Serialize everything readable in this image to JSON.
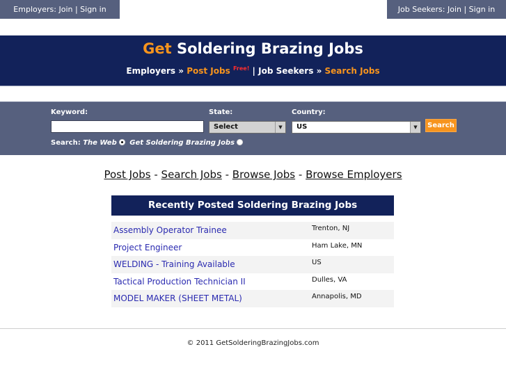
{
  "top": {
    "employers_tab": "Employers: Join | Sign in",
    "jobseekers_tab": "Job Seekers: Join | Sign in"
  },
  "header": {
    "title_accent": "Get",
    "title_rest": "Soldering Brazing Jobs",
    "employers": "Employers",
    "sep1": "»",
    "post_jobs": "Post Jobs",
    "free": "Free!",
    "pipe": "|",
    "job_seekers": "Job Seekers",
    "sep2": "»",
    "search_jobs": "Search Jobs"
  },
  "search": {
    "keyword_label": "Keyword:",
    "keyword_value": "",
    "state_label": "State:",
    "state_value": "Select",
    "country_label": "Country:",
    "country_value": "US",
    "button": "Search",
    "mode_label": "Search:",
    "mode_web": "The Web",
    "mode_site": "Get Soldering Brazing Jobs",
    "selected_mode": "The Web"
  },
  "nav": {
    "post_jobs": "Post Jobs",
    "search_jobs": "Search Jobs",
    "browse_jobs": "Browse Jobs",
    "browse_employers": "Browse Employers",
    "sep": "-"
  },
  "recent": {
    "heading": "Recently Posted Soldering Brazing Jobs",
    "jobs": [
      {
        "title": "Assembly Operator Trainee",
        "location": "Trenton, NJ"
      },
      {
        "title": "Project Engineer",
        "location": "Ham Lake, MN"
      },
      {
        "title": "WELDING - Training Available",
        "location": "US"
      },
      {
        "title": "Tactical Production Technician II",
        "location": "Dulles, VA"
      },
      {
        "title": "MODEL MAKER (SHEET METAL)",
        "location": "Annapolis, MD"
      }
    ]
  },
  "footer": {
    "copyright": "© 2011 GetSolderingBrazingJobs.com"
  },
  "colors": {
    "navy": "#12225a",
    "slate": "#56607e",
    "accent_orange": "#f7941d",
    "free_red": "#ff2d2d",
    "link_blue": "#2a2ab0"
  }
}
